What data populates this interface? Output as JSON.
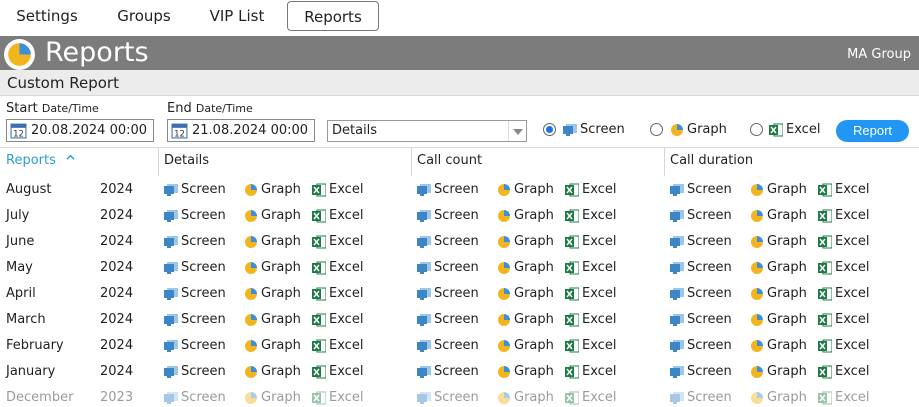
{
  "tabs": [
    {
      "label": "Settings",
      "active": false
    },
    {
      "label": "Groups",
      "active": false
    },
    {
      "label": "VIP List",
      "active": false
    },
    {
      "label": "Reports",
      "active": true
    }
  ],
  "header": {
    "title": "Reports",
    "group": "MA Group"
  },
  "custom_report": {
    "title": "Custom Report",
    "start_label": "Start",
    "start_sub": "Date/Time",
    "start_value": "20.08.2024 00:00",
    "end_label": "End",
    "end_sub": "Date/Time",
    "end_value": "21.08.2024 00:00",
    "report_type": "Details",
    "outputs": [
      {
        "label": "Screen",
        "checked": true
      },
      {
        "label": "Graph",
        "checked": false
      },
      {
        "label": "Excel",
        "checked": false
      }
    ],
    "report_button": "Report"
  },
  "table": {
    "columns": {
      "reports": "Reports",
      "details": "Details",
      "call_count": "Call count",
      "call_duration": "Call duration"
    },
    "actions": {
      "screen": "Screen",
      "graph": "Graph",
      "excel": "Excel"
    },
    "rows": [
      {
        "month": "August",
        "year": "2024"
      },
      {
        "month": "July",
        "year": "2024"
      },
      {
        "month": "June",
        "year": "2024"
      },
      {
        "month": "May",
        "year": "2024"
      },
      {
        "month": "April",
        "year": "2024"
      },
      {
        "month": "March",
        "year": "2024"
      },
      {
        "month": "February",
        "year": "2024"
      },
      {
        "month": "January",
        "year": "2024"
      },
      {
        "month": "December",
        "year": "2023"
      }
    ]
  },
  "colors": {
    "accent": "#2196f3",
    "header_bg": "#7c7c7c",
    "link": "#2a9fd8"
  },
  "icons": {
    "screen": "monitor-icon",
    "graph": "pie-chart-icon",
    "excel": "excel-icon",
    "date": "calendar-icon"
  }
}
